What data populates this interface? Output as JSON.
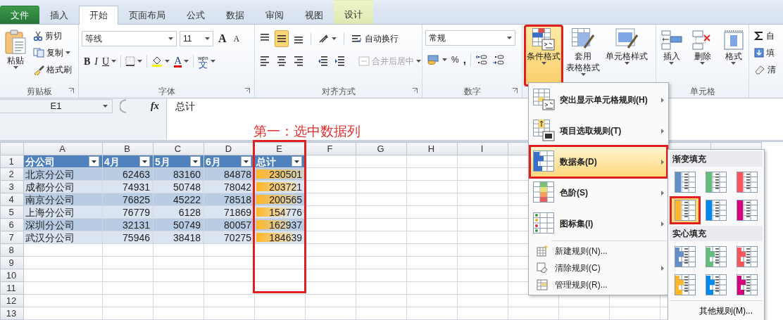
{
  "tabs": [
    {
      "label": "文件",
      "kind": "file",
      "selected": false
    },
    {
      "label": "插入",
      "kind": "tab",
      "selected": false
    },
    {
      "label": "开始",
      "kind": "tab",
      "selected": true
    },
    {
      "label": "页面布局",
      "kind": "tab",
      "selected": false
    },
    {
      "label": "公式",
      "kind": "tab",
      "selected": false
    },
    {
      "label": "数据",
      "kind": "tab",
      "selected": false
    },
    {
      "label": "审阅",
      "kind": "tab",
      "selected": false
    },
    {
      "label": "视图",
      "kind": "tab",
      "selected": false
    },
    {
      "label": "设计",
      "kind": "context",
      "selected": false
    }
  ],
  "clipboard": {
    "label": "剪贴板",
    "paste": "粘贴",
    "cut": "剪切",
    "copy": "复制",
    "format_painter": "格式刷"
  },
  "font": {
    "label": "字体",
    "font_name": "等线",
    "font_size": "11",
    "grow": "A",
    "shrink": "A",
    "styles": [
      "B",
      "I",
      "U"
    ],
    "font_color": "A",
    "phonetic_top": "wén",
    "phonetic": "文"
  },
  "alignment": {
    "label": "对齐方式",
    "vertical": [
      {
        "selected": false
      },
      {
        "selected": true
      },
      {
        "selected": false
      }
    ],
    "wrap_text": "自动换行",
    "merge_center": "合并后居中",
    "merge_disabled": true
  },
  "number": {
    "label": "数字",
    "format": "常规",
    "percent": "%",
    "comma": ","
  },
  "styles": {
    "buttons": [
      {
        "lines": [
          "条件格式"
        ],
        "pressed": true,
        "annotated": true
      },
      {
        "lines": [
          "套用",
          "表格格式"
        ],
        "pressed": false,
        "annotated": false
      },
      {
        "lines": [
          "单元格样式"
        ],
        "pressed": false,
        "annotated": false
      }
    ]
  },
  "cells": {
    "label": "单元格",
    "buttons": [
      "插入",
      "删除",
      "格式"
    ]
  },
  "editing": {
    "items": [
      "自",
      "填",
      "清"
    ]
  },
  "formula_bar": {
    "name_box": "E1",
    "fx": "fx",
    "content": "总计"
  },
  "annotation": "第一：选中数据列",
  "sheet": {
    "columns": [
      {
        "label": "A",
        "annotated": false
      },
      {
        "label": "B",
        "annotated": false
      },
      {
        "label": "C",
        "annotated": false
      },
      {
        "label": "D",
        "annotated": false
      },
      {
        "label": "E",
        "annotated": true
      },
      {
        "label": "F",
        "annotated": false
      },
      {
        "label": "G",
        "annotated": false
      },
      {
        "label": "H",
        "annotated": false
      },
      {
        "label": "I",
        "annotated": false
      }
    ],
    "row_numbers": [
      "1",
      "2",
      "3",
      "4",
      "5",
      "6",
      "7",
      "8",
      "9",
      "10",
      "11",
      "12",
      "13"
    ],
    "headers": [
      "分公司",
      "4月",
      "5月",
      "6月",
      "总计"
    ],
    "rows": [
      {
        "cells": [
          "北京分公司",
          "62463",
          "83160",
          "84878",
          "230501"
        ],
        "level": 1.0
      },
      {
        "cells": [
          "成都分公司",
          "74931",
          "50748",
          "78042",
          "203721"
        ],
        "level": 0.88
      },
      {
        "cells": [
          "南京分公司",
          "76825",
          "45222",
          "78518",
          "200565"
        ],
        "level": 0.87
      },
      {
        "cells": [
          "上海分公司",
          "76779",
          "6128",
          "71869",
          "154776"
        ],
        "level": 0.67
      },
      {
        "cells": [
          "深圳分公司",
          "32131",
          "50749",
          "80057",
          "162937"
        ],
        "level": 0.71
      },
      {
        "cells": [
          "武汉分公司",
          "75946",
          "38418",
          "70275",
          "184639"
        ],
        "level": 0.8
      }
    ]
  },
  "menu": {
    "items": [
      {
        "label": "突出显示单元格规则(H)",
        "kind": "highlight",
        "submenu": true,
        "selected": false,
        "annotated": false
      },
      {
        "label": "项目选取规则(T)",
        "kind": "topbottom",
        "submenu": true,
        "selected": false,
        "annotated": false
      },
      {
        "label": "数据条(D)",
        "kind": "databar",
        "submenu": true,
        "selected": true,
        "annotated": true
      },
      {
        "label": "色阶(S)",
        "kind": "colorscale",
        "submenu": true,
        "selected": false,
        "annotated": false
      },
      {
        "label": "图标集(I)",
        "kind": "iconset",
        "submenu": true,
        "selected": false,
        "annotated": false
      },
      {
        "label": "新建规则(N)...",
        "kind": "new",
        "submenu": false,
        "selected": false,
        "annotated": false
      },
      {
        "label": "清除规则(C)",
        "kind": "clear",
        "submenu": true,
        "selected": false,
        "annotated": false
      },
      {
        "label": "管理规则(R)...",
        "kind": "manage",
        "submenu": false,
        "selected": false,
        "annotated": false
      }
    ]
  },
  "submenu": {
    "sections": [
      {
        "title": "渐变填充",
        "kind": "gradient",
        "swatches": [
          {
            "color": "#638ec6",
            "selected": false
          },
          {
            "color": "#63be7b",
            "selected": false
          },
          {
            "color": "#ff555a",
            "selected": false
          },
          {
            "color": "#ffb628",
            "selected": true
          },
          {
            "color": "#008aef",
            "selected": false
          },
          {
            "color": "#d6007b",
            "selected": false
          }
        ]
      },
      {
        "title": "实心填充",
        "kind": "solid",
        "swatches": [
          {
            "color": "#638ec6",
            "selected": false
          },
          {
            "color": "#63be7b",
            "selected": false
          },
          {
            "color": "#ff555a",
            "selected": false
          },
          {
            "color": "#ffb628",
            "selected": false
          },
          {
            "color": "#008aef",
            "selected": false
          },
          {
            "color": "#d6007b",
            "selected": false
          }
        ]
      }
    ],
    "footer": "其他规则(M)..."
  }
}
